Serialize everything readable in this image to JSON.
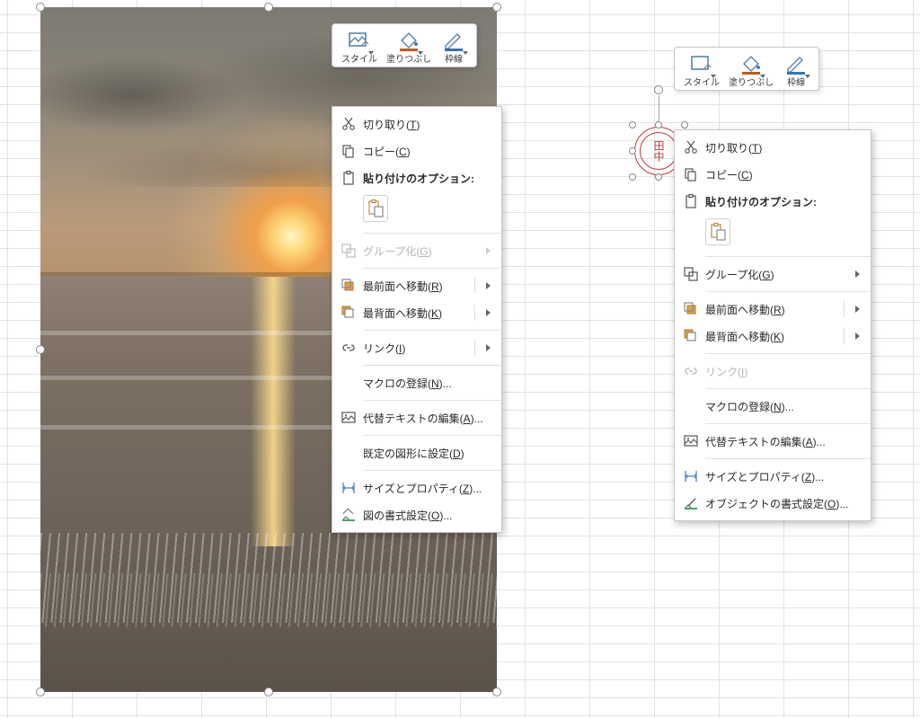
{
  "mini_toolbar": {
    "style": "スタイル",
    "fill": "塗りつぶし",
    "outline": "枠線"
  },
  "menu": {
    "cut": "切り取り(T)",
    "copy": "コピー(C)",
    "paste_options_header": "貼り付けのオプション:",
    "group": "グループ化(G)",
    "bring_to_front": "最前面へ移動(R)",
    "send_to_back": "最背面へ移動(K)",
    "link": "リンク(I)",
    "assign_macro": "マクロの登録(N)...",
    "edit_alt_text": "代替テキストの編集(A)...",
    "set_default_shape": "既定の図形に設定(D)",
    "size_properties": "サイズとプロパティ(Z)...",
    "format_picture": "図の書式設定(O)...",
    "format_object": "オブジェクトの書式設定(O)..."
  },
  "stamp_text": "田中",
  "colors": {
    "accent_fill": "#c55a11",
    "accent_outline": "#2e75b6",
    "stamp": "#bf3a3a"
  }
}
